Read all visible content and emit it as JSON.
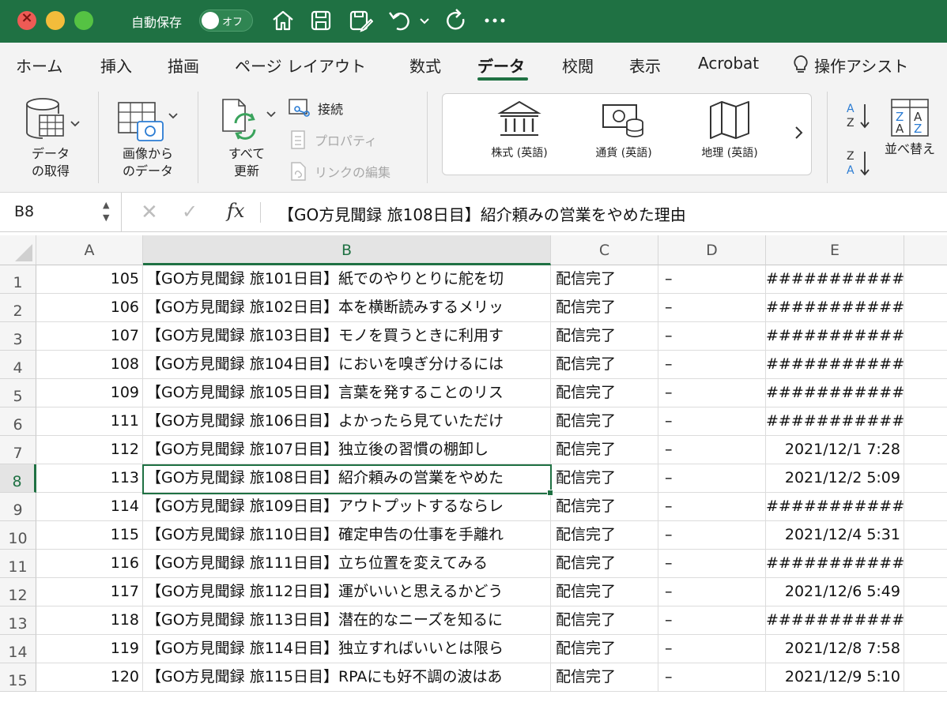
{
  "titlebar": {
    "autosave_label": "自動保存",
    "autosave_state": "オフ",
    "icons": [
      "home-icon",
      "save-icon",
      "save-as-icon",
      "undo-icon",
      "chevron-down-icon",
      "redo-icon",
      "more-icon"
    ]
  },
  "tabs": [
    {
      "label": "ホーム"
    },
    {
      "label": "挿入"
    },
    {
      "label": "描画"
    },
    {
      "label": "ページ レイアウト"
    },
    {
      "label": "数式"
    },
    {
      "label": "データ"
    },
    {
      "label": "校閲"
    },
    {
      "label": "表示"
    },
    {
      "label": "Acrobat"
    },
    {
      "label": "操作アシスト"
    }
  ],
  "ribbon": {
    "get_data": [
      "データ",
      "の取得"
    ],
    "from_image": [
      "画像から",
      "のデータ"
    ],
    "refresh_all": [
      "すべて",
      "更新"
    ],
    "connections": "接続",
    "properties": "プロパティ",
    "edit_links": "リンクの編集",
    "data_types": [
      {
        "label": "株式 (英語)"
      },
      {
        "label": "通貨 (英語)"
      },
      {
        "label": "地理 (英語)"
      }
    ],
    "sort": "並べ替え"
  },
  "formula_bar": {
    "name_box": "B8",
    "fx": "fx",
    "formula": "【GO方見聞録 旅108日目】紹介頼みの営業をやめた理由"
  },
  "sheet": {
    "columns": [
      "A",
      "B",
      "C",
      "D",
      "E"
    ],
    "rows": [
      {
        "n": "1",
        "a": "105",
        "b": "【GO方見聞録 旅101日目】紙でのやりとりに舵を切",
        "c": "配信完了",
        "d": "–",
        "e": "############"
      },
      {
        "n": "2",
        "a": "106",
        "b": "【GO方見聞録 旅102日目】本を横断読みするメリッ",
        "c": "配信完了",
        "d": "–",
        "e": "############"
      },
      {
        "n": "3",
        "a": "107",
        "b": "【GO方見聞録 旅103日目】モノを買うときに利用す",
        "c": "配信完了",
        "d": "–",
        "e": "############"
      },
      {
        "n": "4",
        "a": "108",
        "b": "【GO方見聞録 旅104日目】においを嗅ぎ分けるには",
        "c": "配信完了",
        "d": "–",
        "e": "############"
      },
      {
        "n": "5",
        "a": "109",
        "b": "【GO方見聞録 旅105日目】言葉を発することのリス",
        "c": "配信完了",
        "d": "–",
        "e": "############"
      },
      {
        "n": "6",
        "a": "111",
        "b": "【GO方見聞録 旅106日目】よかったら見ていただけ",
        "c": "配信完了",
        "d": "–",
        "e": "############"
      },
      {
        "n": "7",
        "a": "112",
        "b": "【GO方見聞録 旅107日目】独立後の習慣の棚卸し",
        "c": "配信完了",
        "d": "–",
        "e": "2021/12/1 7:28"
      },
      {
        "n": "8",
        "a": "113",
        "b": "【GO方見聞録 旅108日目】紹介頼みの営業をやめた",
        "c": "配信完了",
        "d": "–",
        "e": "2021/12/2 5:09"
      },
      {
        "n": "9",
        "a": "114",
        "b": "【GO方見聞録 旅109日目】アウトプットするならレ",
        "c": "配信完了",
        "d": "–",
        "e": "############"
      },
      {
        "n": "10",
        "a": "115",
        "b": "【GO方見聞録 旅110日目】確定申告の仕事を手離れ",
        "c": "配信完了",
        "d": "–",
        "e": "2021/12/4 5:31"
      },
      {
        "n": "11",
        "a": "116",
        "b": "【GO方見聞録 旅111日目】立ち位置を変えてみる",
        "c": "配信完了",
        "d": "–",
        "e": "############"
      },
      {
        "n": "12",
        "a": "117",
        "b": "【GO方見聞録 旅112日目】運がいいと思えるかどう",
        "c": "配信完了",
        "d": "–",
        "e": "2021/12/6 5:49"
      },
      {
        "n": "13",
        "a": "118",
        "b": "【GO方見聞録 旅113日目】潜在的なニーズを知るに",
        "c": "配信完了",
        "d": "–",
        "e": "############"
      },
      {
        "n": "14",
        "a": "119",
        "b": "【GO方見聞録 旅114日目】独立すればいいとは限ら",
        "c": "配信完了",
        "d": "–",
        "e": "2021/12/8 7:58"
      },
      {
        "n": "15",
        "a": "120",
        "b": "【GO方見聞録 旅115日目】RPAにも好不調の波はあ",
        "c": "配信完了",
        "d": "–",
        "e": "2021/12/9 5:10"
      }
    ],
    "selected_cell": "B8"
  },
  "colors": {
    "accent": "#1f7143",
    "ribbon_bg": "#f3f3f3"
  }
}
